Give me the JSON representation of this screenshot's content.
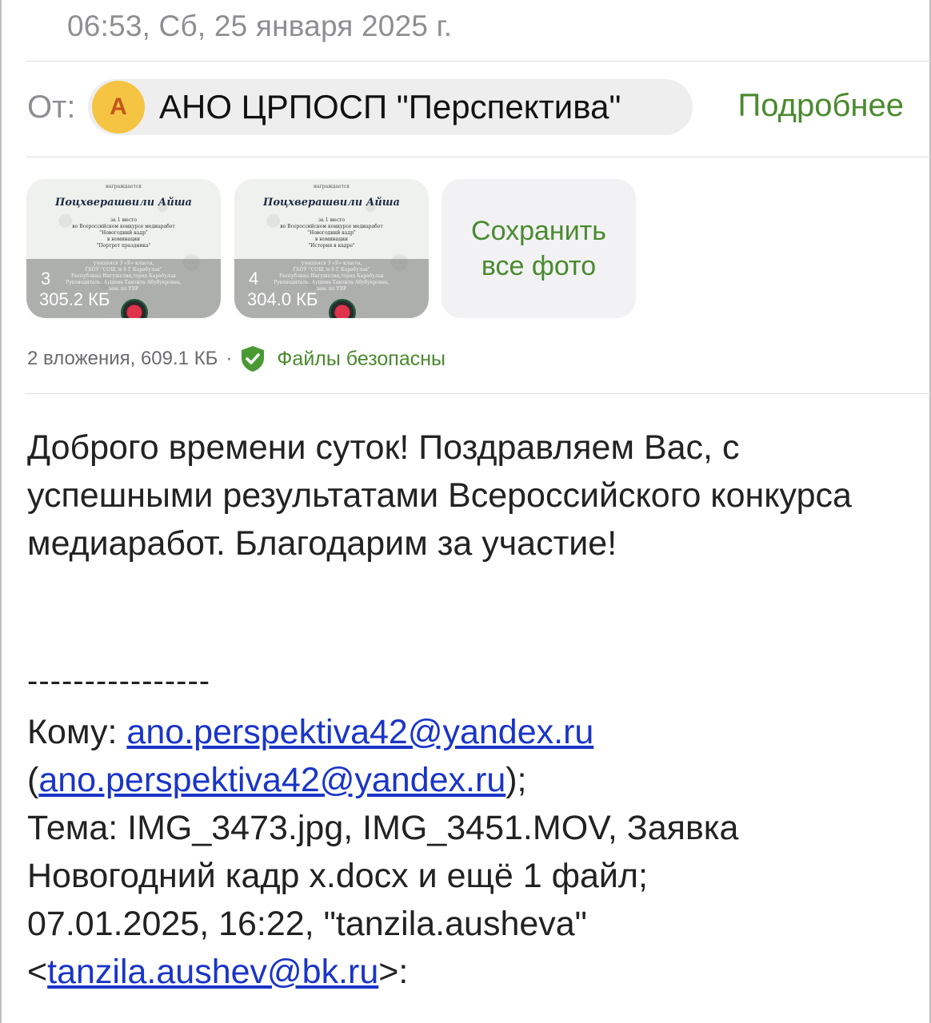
{
  "header": {
    "datetime": "06:53, Сб, 25 января 2025 г."
  },
  "from": {
    "label": "От:",
    "avatar_letter": "А",
    "sender_name": "АНО ЦРПОСП \"Перспектива\"",
    "details_link": "Подробнее"
  },
  "attachments": {
    "items": [
      {
        "index": "3",
        "size": "305.2 КБ",
        "doc_name": "Поцхверашвили Айша",
        "doc_top": "награждается",
        "doc_lines": [
          "за 1 место",
          "во Всероссийском конкурсе медиаработ",
          "\"Новогодний кадр\"",
          "в номинации",
          "\"Портрет праздника\""
        ],
        "band_lines": [
          "учащаяся 3 «Б» класса,",
          "ГБОУ \"СОШ № 6 Г.Карабулак\"",
          "Республика Ингушетия,город Карабулак",
          "Руководитель: Аушева Танзила Абубукровна,",
          "зам. по УВР"
        ]
      },
      {
        "index": "4",
        "size": "304.0 КБ",
        "doc_name": "Поцхверашвили Айша",
        "doc_top": "награждается",
        "doc_lines": [
          "за 1 место",
          "во Всероссийском конкурсе медиаработ",
          "\"Новогодний кадр\"",
          "в номинации",
          "\"История в кадре\""
        ],
        "band_lines": [
          "учащаяся 3 «Б» класса,",
          "ГБОУ \"СОШ № 6 Г.Карабулак\"",
          "Республика Ингушетия,город Карабулак",
          "Руководитель: Аушева Танзила Абубукровна,",
          "зам. по УВР"
        ]
      }
    ],
    "save_all_line1": "Сохранить",
    "save_all_line2": "все фото",
    "summary": "2 вложения, 609.1 КБ",
    "dot": "·",
    "safe_text": "Файлы безопасны"
  },
  "body": {
    "greeting": "Доброго времени суток! Поздравляем Вас, с успешными результатами Всероссийского конкурса медиаработ. Благодарим за участие!",
    "separator": "----------------",
    "to_label": "Кому: ",
    "to_email": "ano.perspektiva42@yandex.ru",
    "to_paren_open": "(",
    "to_email_2": "ano.perspektiva42@yandex.ru",
    "to_paren_close": ");",
    "subject": "Тема: IMG_3473.jpg, IMG_3451.MOV, Заявка Новогодний кадр x.docx и ещё 1 файл;",
    "sent_line": "07.01.2025, 16:22, \"tanzila.ausheva\"",
    "lt": "<",
    "sender_email": "tanzila.aushev@bk.ru",
    "gt": ">:"
  },
  "colors": {
    "accent_green": "#4a8a2f",
    "link_blue": "#1a35c7",
    "avatar_yellow": "#f6c443"
  },
  "icons": {
    "shield": "shield-check-icon"
  }
}
